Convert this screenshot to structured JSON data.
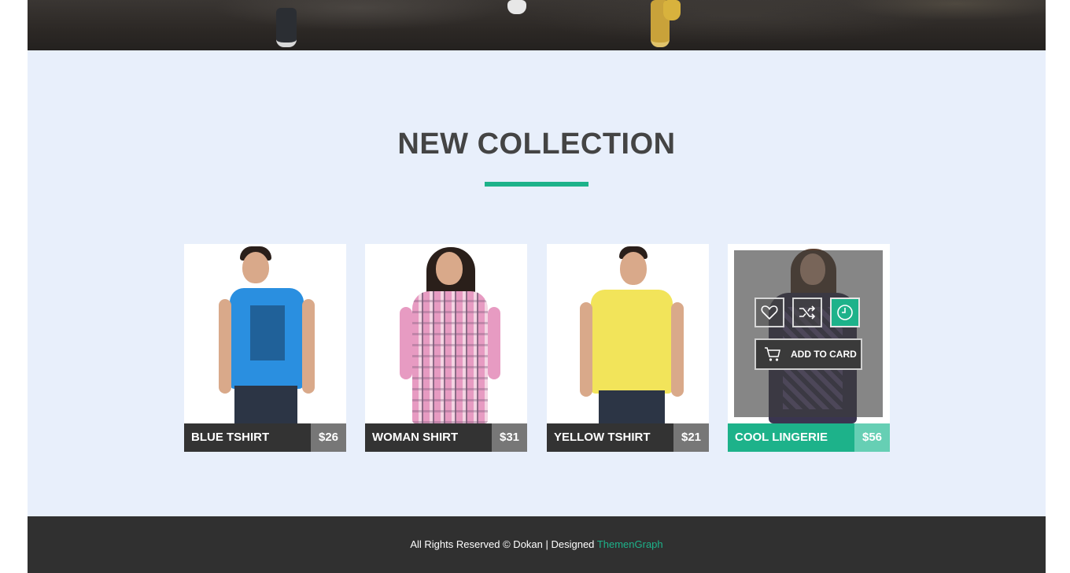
{
  "section": {
    "title": "NEW COLLECTION",
    "accent_color": "#1db28a"
  },
  "products": [
    {
      "name": "BLUE TSHIRT",
      "price": "$26",
      "shirt_color": "#2a8fe0"
    },
    {
      "name": "WOMAN SHIRT",
      "price": "$31",
      "shirt_color": "#e79bc2"
    },
    {
      "name": "YELLOW TSHIRT",
      "price": "$21",
      "shirt_color": "#f2e45a"
    },
    {
      "name": "COOL LINGERIE",
      "price": "$56",
      "shirt_color": "#3a3550"
    }
  ],
  "overlay": {
    "icons": [
      "heart-icon",
      "shuffle-icon",
      "clock-icon"
    ],
    "add_to_cart_label": "ADD TO CARD",
    "cart_icon": "cart-icon"
  },
  "footer": {
    "text": "All Rights Reserved © Dokan | Designed",
    "link_text": "ThemenGraph"
  }
}
